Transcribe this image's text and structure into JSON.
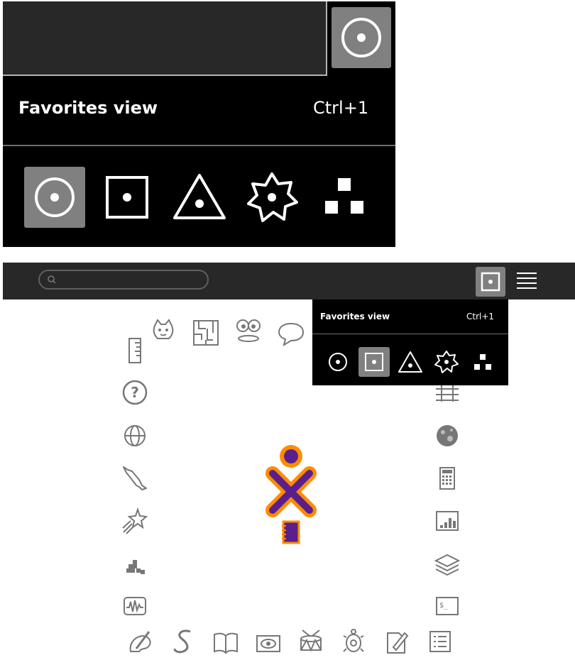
{
  "zoom_panel": {
    "title": "Favorites view",
    "shortcut": "Ctrl+1",
    "views": [
      {
        "name": "favorites-view",
        "icon": "ring-dot-icon",
        "active": true
      },
      {
        "name": "home-view",
        "icon": "square-dot-icon",
        "active": false
      },
      {
        "name": "group-view",
        "icon": "triangle-dot-icon",
        "active": false
      },
      {
        "name": "neighborhood-view",
        "icon": "gear-dot-icon",
        "active": false
      },
      {
        "name": "list-view",
        "icon": "blocks-icon",
        "active": false
      }
    ]
  },
  "toolbar": {
    "search_placeholder": "",
    "current_view_icon": "square-dot-icon",
    "list_icon": "hamburger-icon"
  },
  "menu": {
    "title": "Favorites view",
    "shortcut": "Ctrl+1",
    "active_view": "home-view"
  },
  "activities": [
    "scratch-cat-icon",
    "maze-icon",
    "speak-face-icon",
    "chat-bubble-icon",
    "ruler-icon",
    "help-icon",
    "browse-globe-icon",
    "dolphin-icon",
    "star-icon",
    "blocks-icon",
    "measure-icon",
    "abacus-icon",
    "moon-icon",
    "calculator-icon",
    "chart-icon",
    "library-icon",
    "terminal-icon",
    "paint-icon",
    "turtle-snake-icon",
    "book-icon",
    "record-eye-icon",
    "drum-icon",
    "turtle-icon",
    "write-icon",
    "list-icon"
  ],
  "colors": {
    "xo_stroke": "#ff8c00",
    "xo_fill": "#5b1f8c",
    "toolbar_bg": "#282828",
    "active_button": "#808080"
  }
}
